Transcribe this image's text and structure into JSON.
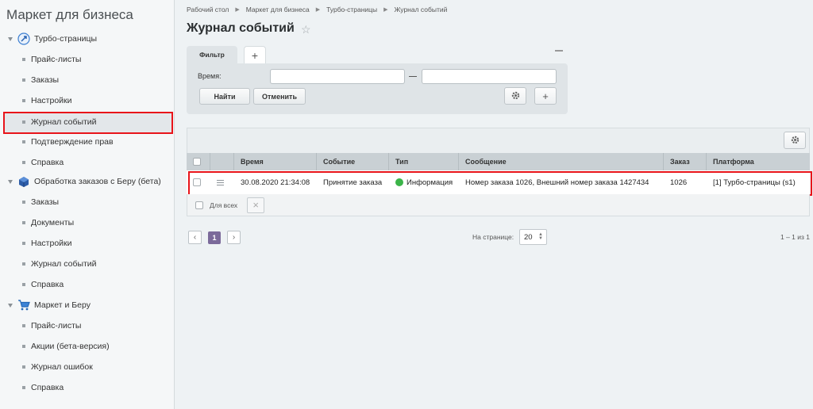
{
  "sidebar": {
    "title": "Маркет для бизнеса",
    "sections": [
      {
        "label": "Турбо-страницы",
        "items": [
          "Прайс-листы",
          "Заказы",
          "Настройки",
          "Журнал событий",
          "Подтверждение прав",
          "Справка"
        ]
      },
      {
        "label": "Обработка заказов с Беру (бета)",
        "items": [
          "Заказы",
          "Документы",
          "Настройки",
          "Журнал событий",
          "Справка"
        ]
      },
      {
        "label": "Маркет и Беру",
        "items": [
          "Прайс-листы",
          "Акции (бета-версия)",
          "Журнал ошибок",
          "Справка"
        ]
      }
    ],
    "active_item": "Журнал событий"
  },
  "breadcrumbs": [
    "Рабочий стол",
    "Маркет для бизнеса",
    "Турбо-страницы",
    "Журнал событий"
  ],
  "page": {
    "title": "Журнал событий"
  },
  "filter": {
    "tab_label": "Фильтр",
    "add_tab": "+",
    "time_label": "Время:",
    "date_from": "",
    "date_to": "",
    "find_button": "Найти",
    "cancel_button": "Отменить",
    "add_button": "+"
  },
  "grid": {
    "columns": [
      "Время",
      "Событие",
      "Тип",
      "Сообщение",
      "Заказ",
      "Платформа"
    ],
    "rows": [
      {
        "time": "30.08.2020 21:34:08",
        "event": "Принятие заказа",
        "type": "Информация",
        "message": "Номер заказа 1026, Внешний номер заказа 1427434",
        "order": "1026",
        "platform": "[1] Турбо-страницы (s1)"
      }
    ],
    "for_all_label": "Для всех",
    "delete_icon": "×"
  },
  "pagination": {
    "prev": "‹",
    "current_page": "1",
    "next": "›",
    "per_page_label": "На странице:",
    "per_page_value": "20",
    "total": "1 – 1 из 1"
  },
  "colors": {
    "accent": "#7b6a9a",
    "highlight": "#e8141a",
    "info": "#3bb449",
    "link": "#2b6ca3"
  }
}
